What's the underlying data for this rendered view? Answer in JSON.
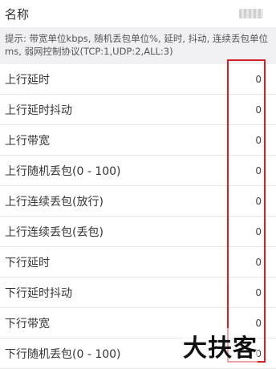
{
  "header": {
    "title": "名称"
  },
  "hint": "提示: 带宽单位kbps, 随机丢包单位%, 延时, 抖动, 连续丢包单位ms, 弱网控制协议(TCP:1,UDP:2,ALL:3)",
  "rows": [
    {
      "label": "上行延时",
      "value": "0"
    },
    {
      "label": "上行延时抖动",
      "value": "0"
    },
    {
      "label": "上行带宽",
      "value": "0"
    },
    {
      "label": "上行随机丢包(0 - 100)",
      "value": "0"
    },
    {
      "label": "上行连续丢包(放行)",
      "value": "0"
    },
    {
      "label": "上行连续丢包(丢包)",
      "value": "0"
    },
    {
      "label": "下行延时",
      "value": "0"
    },
    {
      "label": "下行延时抖动",
      "value": "0"
    },
    {
      "label": "下行带宽",
      "value": "0"
    },
    {
      "label": "下行随机丢包(0 - 100)",
      "value": "0"
    }
  ],
  "watermark": "大扶客",
  "colors": {
    "highlight": "#d21f27",
    "hint_bg": "#efeff4"
  }
}
